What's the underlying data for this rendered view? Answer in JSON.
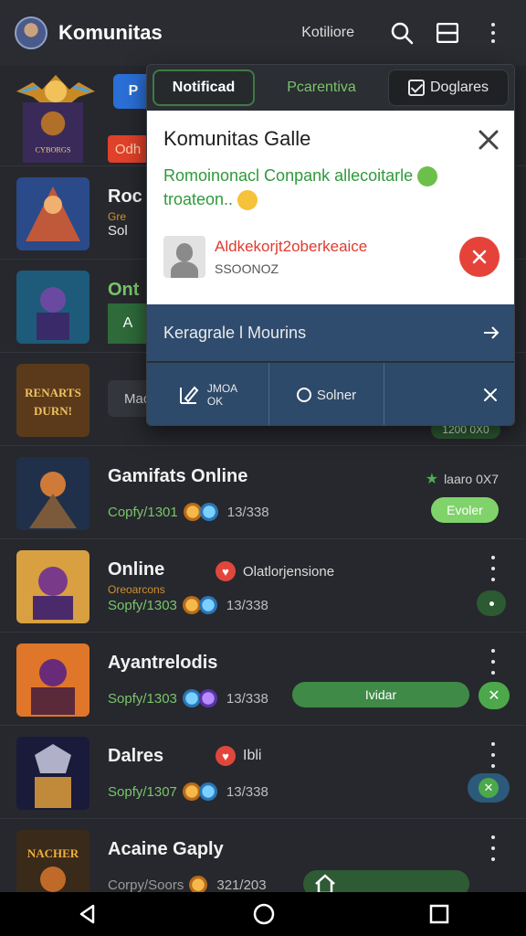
{
  "appbar": {
    "title": "Komunitas",
    "filter_label": "Kotiliore"
  },
  "subhead": {
    "blue_button": "P"
  },
  "popup": {
    "tabs": {
      "notif": "Notificad",
      "second": "Pcarentiva",
      "third": "Doglares"
    },
    "card": {
      "title": "Komunitas Galle",
      "desc_line1": "Romoinonacl Conpank allecoitarle",
      "desc_line2": "troateon..",
      "user_name": "Aldkekorjt2oberkeaice",
      "user_handle": "SSOONOZ"
    },
    "bar_label": "Keragrale l Mourins",
    "actions": {
      "a1_top": "JMOA",
      "a1_bottom": "OK",
      "a2": "Solner"
    }
  },
  "list": {
    "row1": {
      "tag": "Odh"
    },
    "row2": {
      "title": "Roc",
      "sub": "Gre",
      "meta": "Sol"
    },
    "row3": {
      "title": "Ont",
      "letter": "A"
    },
    "row4": {
      "button": "Mach",
      "score": "1200 0X0"
    },
    "row5": {
      "title": "Gamifats Online",
      "meta": "Copfy/1301",
      "count": "13/338",
      "rating": "laaro 0X7",
      "pill": "Evoler"
    },
    "row6": {
      "title": "Online",
      "sub": "Oreoarcons",
      "meta": "Sopfy/1303",
      "count": "13/338",
      "user": "Olatlorjensione"
    },
    "row7": {
      "title": "Ayantrelodis",
      "meta": "Sopfy/1303",
      "count": "13/338",
      "pill": "Ividar"
    },
    "row8": {
      "title": "Dalres",
      "meta": "Sopfy/1307",
      "count": "13/338",
      "user": "Ibli"
    },
    "row9": {
      "title": "Acaine Gaply",
      "meta": "Corpy/Soors",
      "count": "321/203"
    }
  },
  "thumbs": {
    "t4_text1": "RENARTS",
    "t4_text2": "DURN!",
    "t1_text": "CYBORGS",
    "t9_text": "NACHER"
  },
  "colors": {
    "accent_green": "#7ac46b",
    "accent_red": "#e5433a",
    "panel_blue": "#2f4c6e"
  }
}
